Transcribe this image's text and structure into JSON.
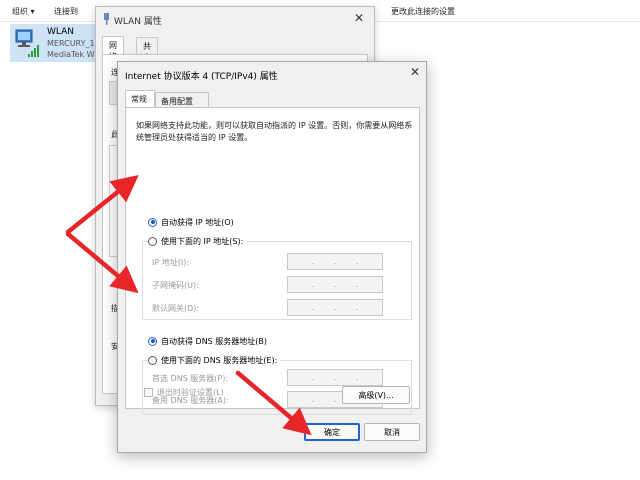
{
  "explorer": {
    "toolbar": {
      "organize": "组织 ▾",
      "connect_to": "连接到",
      "change_settings": "更改此连接的设置"
    },
    "adapter": {
      "name": "WLAN",
      "network": "MERCURY_1",
      "device": "MediaTek W"
    }
  },
  "wlan_window": {
    "title": "WLAN 属性",
    "tabs": [
      "网络",
      "共享"
    ],
    "fragments": [
      "连",
      "此",
      "描",
      "安"
    ]
  },
  "ipv4_dialog": {
    "title": "Internet 协议版本 4 (TCP/IPv4) 属性",
    "close": "✕",
    "tabs": {
      "general": "常规",
      "alternate": "备用配置"
    },
    "description": "如果网络支持此功能，则可以获取自动指派的 IP 设置。否则，你需要从网络系统管理员处获得适当的 IP 设置。",
    "ip": {
      "auto_label": "自动获得 IP 地址(O)",
      "auto_selected": true,
      "manual_label": "使用下面的 IP 地址(S):",
      "fields": [
        {
          "label": "IP 地址(I):",
          "value": ". . ."
        },
        {
          "label": "子网掩码(U):",
          "value": ". . ."
        },
        {
          "label": "默认网关(D):",
          "value": ". . ."
        }
      ]
    },
    "dns": {
      "auto_label": "自动获得 DNS 服务器地址(B)",
      "auto_selected": true,
      "manual_label": "使用下面的 DNS 服务器地址(E):",
      "fields": [
        {
          "label": "首选 DNS 服务器(P):",
          "value": ". . ."
        },
        {
          "label": "备用 DNS 服务器(A):",
          "value": ". . ."
        }
      ]
    },
    "validate_label": "退出时验证设置(L)",
    "validate_checked": false,
    "buttons": {
      "advanced": "高级(V)...",
      "ok": "确定",
      "cancel": "取消"
    }
  },
  "colors": {
    "annotation_arrow": "#e8262a",
    "accent": "#1a56c8",
    "adapter_highlight": "#cfe3f7"
  }
}
